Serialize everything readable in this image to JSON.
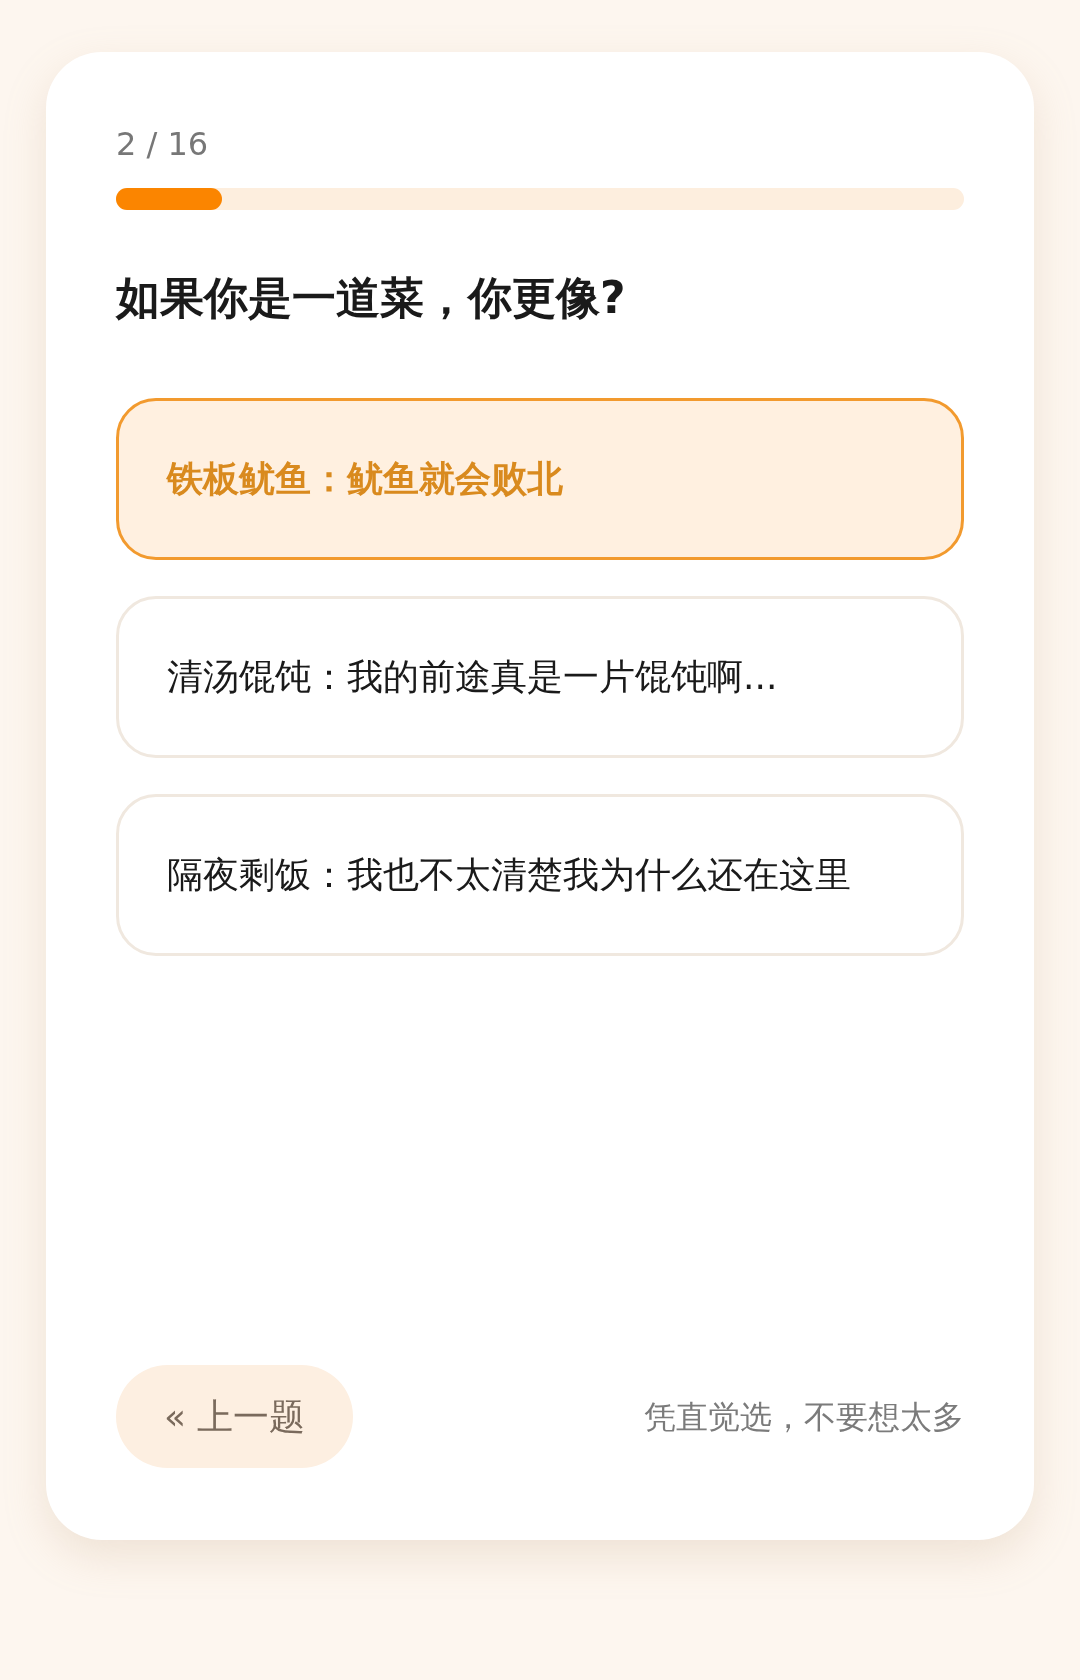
{
  "progress": {
    "text": "2 / 16",
    "level": 0.125
  },
  "question": "如果你是一道菜，你更像?",
  "options": [
    {
      "label": "铁板鱿鱼：鱿鱼就会败北",
      "selected": true
    },
    {
      "label": "清汤馄饨：我的前途真是一片馄饨啊...",
      "selected": false
    },
    {
      "label": "隔夜剩饭：我也不太清楚我为什么还在这里",
      "selected": false
    }
  ],
  "prev_button": "« 上一题",
  "hint": "凭直觉选，不要想太多"
}
